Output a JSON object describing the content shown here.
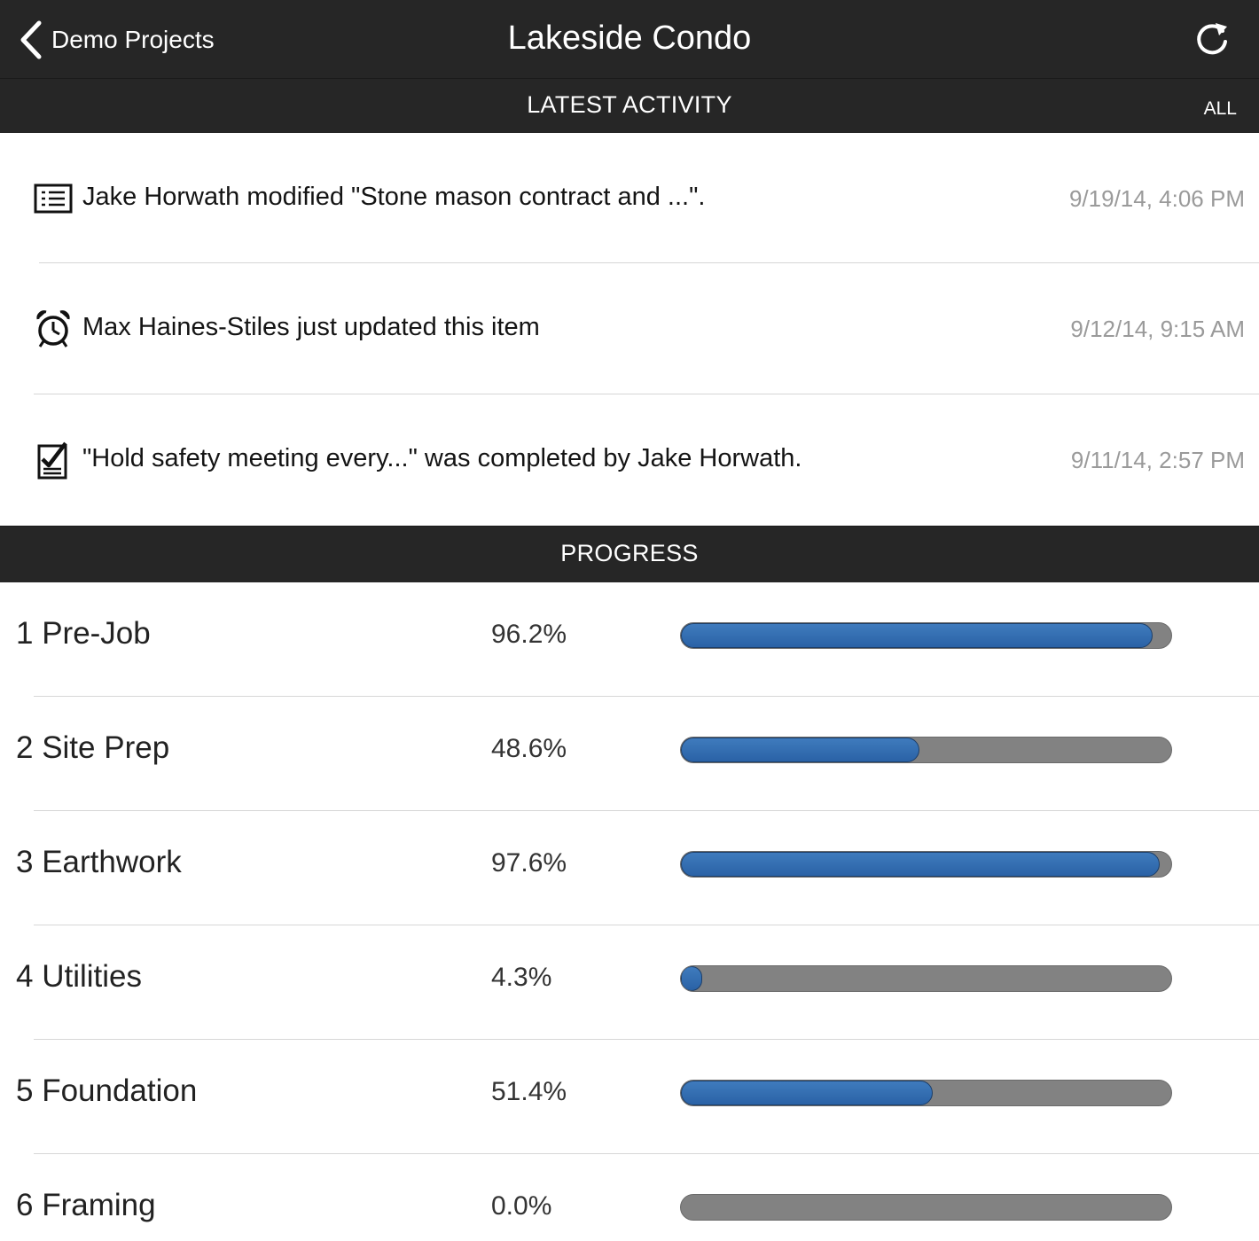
{
  "header": {
    "back_label": "Demo Projects",
    "title": "Lakeside Condo",
    "back_icon": "chevron-left-icon",
    "refresh_icon": "refresh-icon"
  },
  "latest_activity": {
    "title": "LATEST ACTIVITY",
    "all_label": "ALL",
    "items": [
      {
        "icon": "checklist-icon",
        "text": "Jake Horwath modified \"Stone mason contract and ...\".",
        "timestamp": "9/19/14, 4:06 PM"
      },
      {
        "icon": "alarm-clock-icon",
        "text": "Max Haines-Stiles just updated this item",
        "timestamp": "9/12/14, 9:15 AM"
      },
      {
        "icon": "completed-checklist-icon",
        "text": "\"Hold safety meeting every...\" was completed by Jake Horwath.",
        "timestamp": "9/11/14, 2:57 PM"
      }
    ]
  },
  "progress": {
    "title": "PROGRESS",
    "items": [
      {
        "label": "1 Pre-Job",
        "percent_text": "96.2%",
        "value": 96.2
      },
      {
        "label": "2 Site Prep",
        "percent_text": "48.6%",
        "value": 48.6
      },
      {
        "label": "3 Earthwork",
        "percent_text": "97.6%",
        "value": 97.6
      },
      {
        "label": "4 Utilities",
        "percent_text": "4.3%",
        "value": 4.3
      },
      {
        "label": "5 Foundation",
        "percent_text": "51.4%",
        "value": 51.4
      },
      {
        "label": "6 Framing",
        "percent_text": "0.0%",
        "value": 0.0
      }
    ]
  },
  "colors": {
    "bar_background": "#262626",
    "progress_fill": "#2f6aad",
    "progress_track": "#828282",
    "timestamp": "#9a9a9a"
  }
}
